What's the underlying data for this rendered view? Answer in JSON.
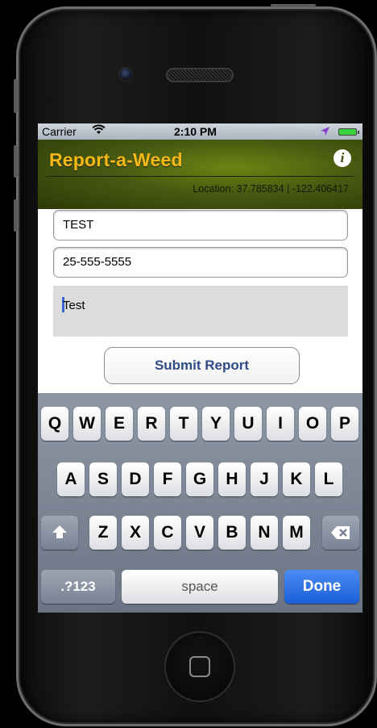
{
  "status_bar": {
    "carrier": "Carrier",
    "time": "2:10 PM"
  },
  "header": {
    "title": "Report-a-Weed",
    "info_glyph": "i",
    "location": "Location: 37.785834 | -122.406417"
  },
  "form": {
    "name_value": "TEST",
    "phone_value": "25-555-5555",
    "notes_value": "Test",
    "submit_label": "Submit Report"
  },
  "keyboard": {
    "row1": [
      "Q",
      "W",
      "E",
      "R",
      "T",
      "Y",
      "U",
      "I",
      "O",
      "P"
    ],
    "row2": [
      "A",
      "S",
      "D",
      "F",
      "G",
      "H",
      "J",
      "K",
      "L"
    ],
    "row3": [
      "Z",
      "X",
      "C",
      "V",
      "B",
      "N",
      "M"
    ],
    "numbers_label": ".?123",
    "space_label": "space",
    "done_label": "Done"
  },
  "icons": {
    "wifi": "wifi-icon",
    "location_arrow": "location-arrow-icon",
    "battery": "battery-icon",
    "info": "info-icon",
    "shift": "shift-icon",
    "backspace": "backspace-icon"
  },
  "colors": {
    "title": "#f6b916",
    "header_bg": "#475911",
    "done_key": "#1b5fd8",
    "submit_text": "#2e4b86",
    "cursor": "#3d63d6"
  }
}
